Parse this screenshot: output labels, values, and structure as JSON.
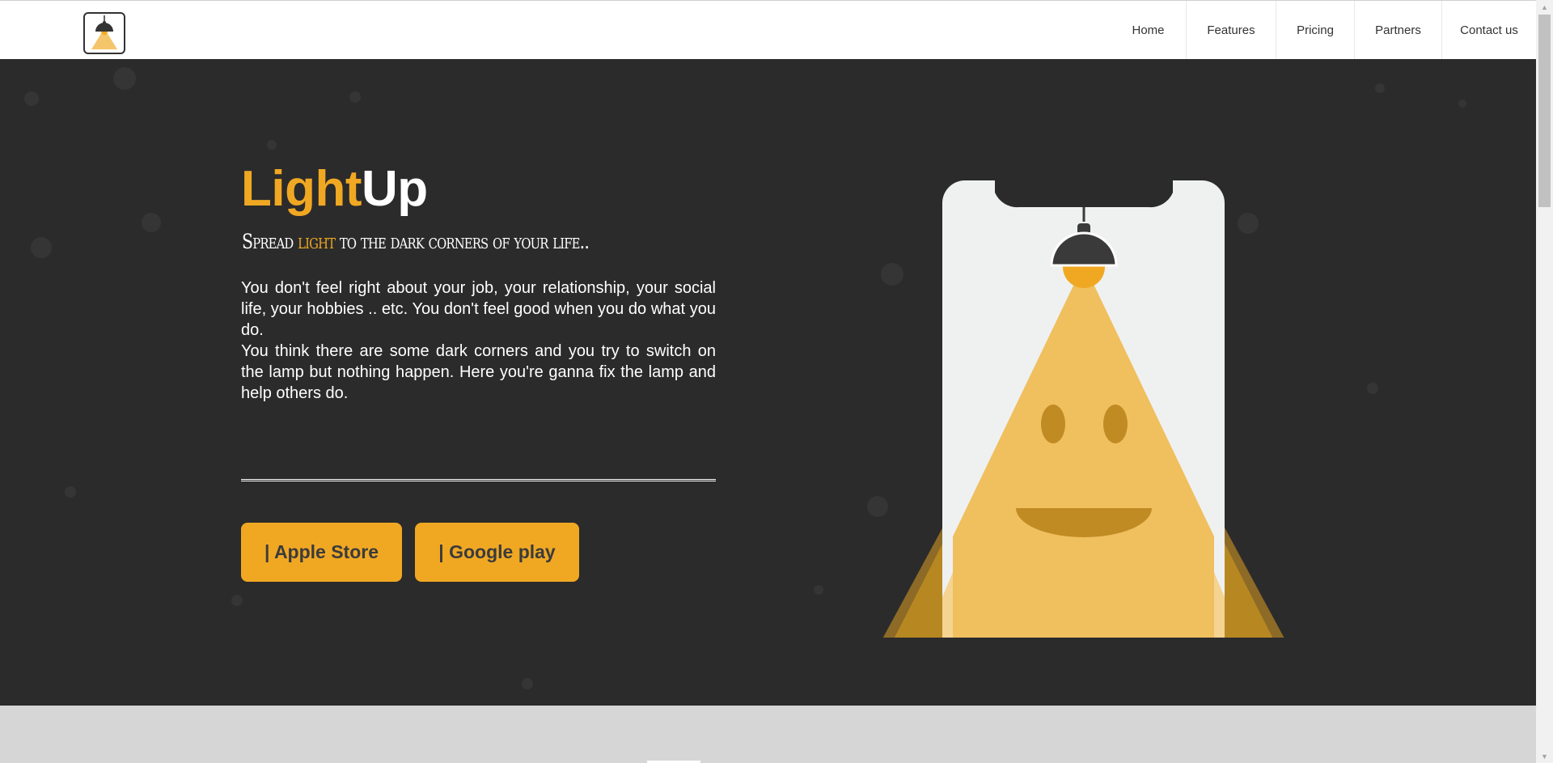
{
  "brand": {
    "logo_icon": "hanging-lamp-icon",
    "accent": "#f0a823",
    "dark_bg": "#2b2b2b"
  },
  "nav": {
    "items": [
      {
        "label": "Home"
      },
      {
        "label": "Features"
      },
      {
        "label": "Pricing"
      },
      {
        "label": "Partners"
      },
      {
        "label": "Contact us"
      }
    ]
  },
  "hero": {
    "title_light": "Light",
    "title_up": "Up",
    "tagline_before": "Spread ",
    "tagline_highlight": "light",
    "tagline_after": " to the dark corners of your life..",
    "paragraph_1": "You don't feel right about your job, your relationship, your social life, your hobbies .. etc. You don't feel good when you do what you do.",
    "paragraph_2": "You think there are some dark corners and you try to switch on the lamp but nothing happen. Here you're ganna fix the lamp and help others do.",
    "buttons": {
      "apple": "| Apple Store",
      "google": "| Google play"
    },
    "illustration_icon": "smiling-phone-lamp-illustration"
  }
}
